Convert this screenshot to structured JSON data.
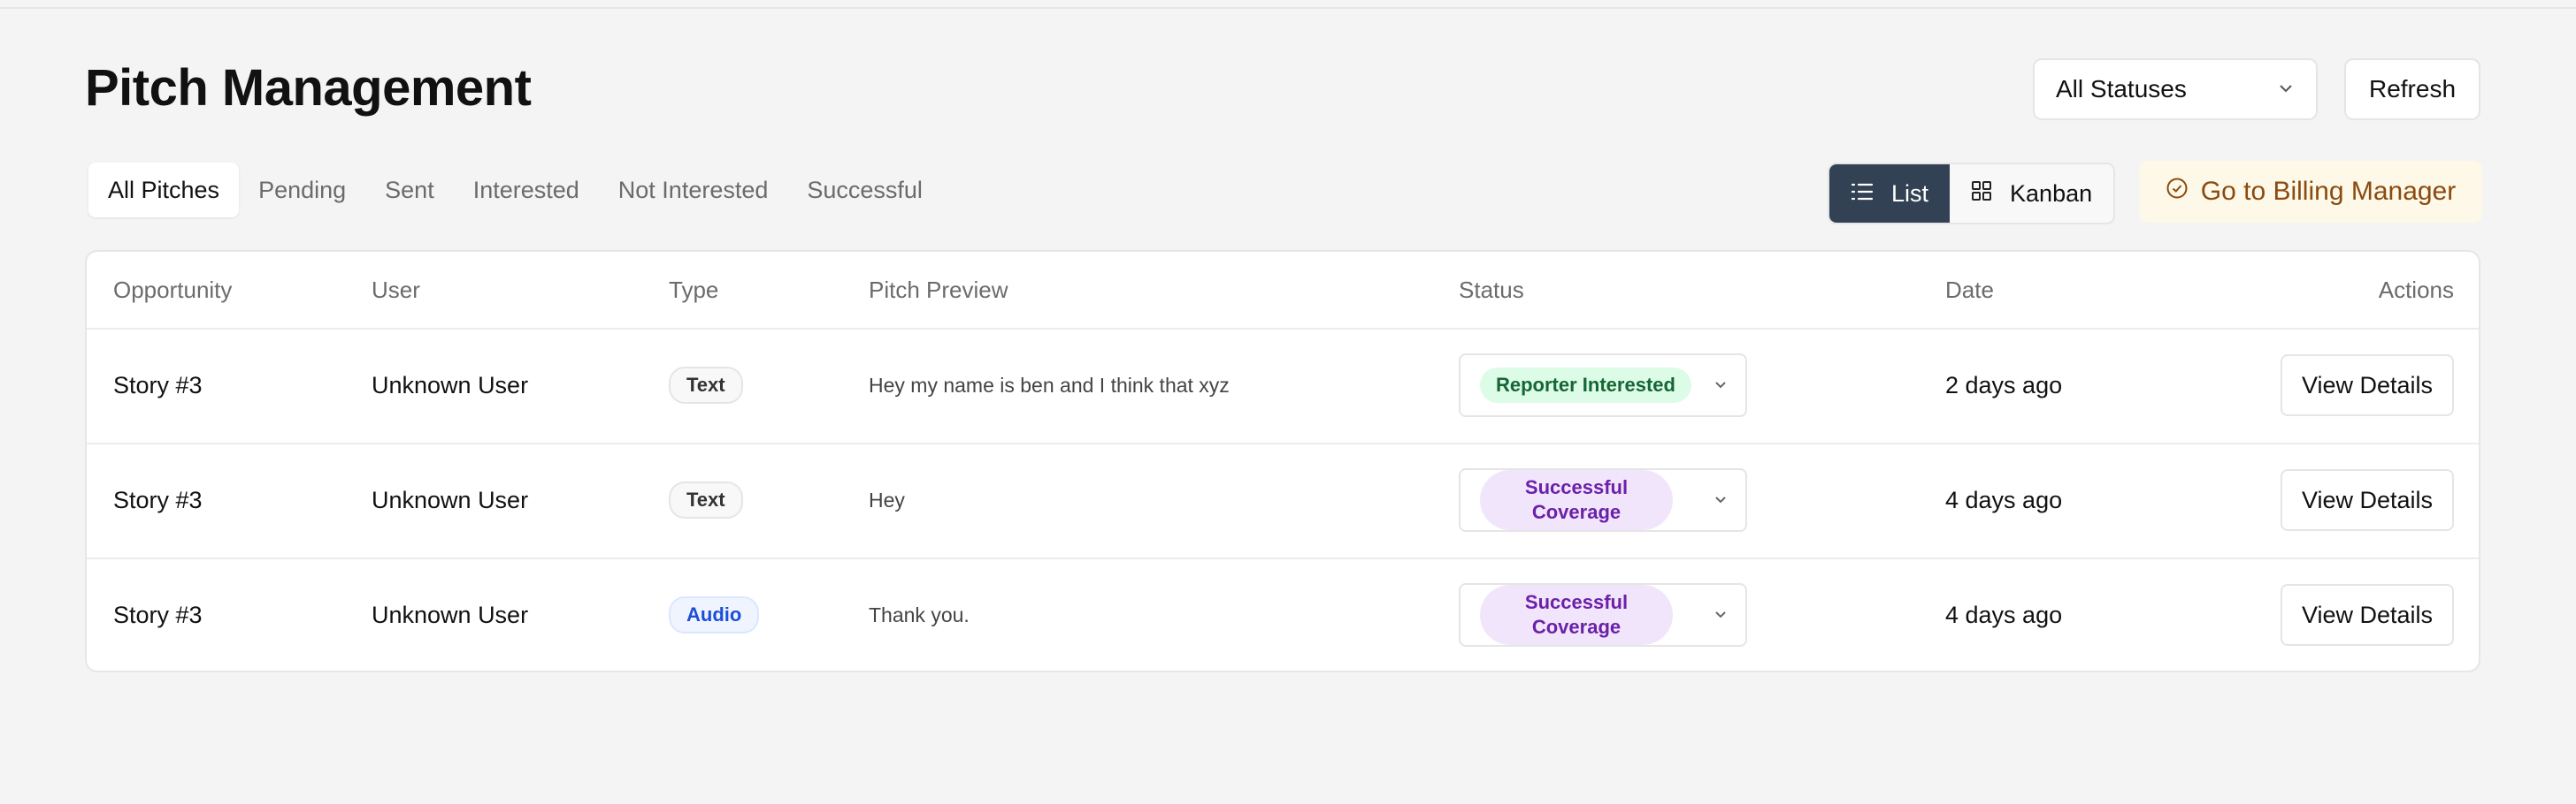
{
  "header": {
    "title": "Pitch Management",
    "status_filter": {
      "selected": "All Statuses"
    },
    "refresh_label": "Refresh"
  },
  "tabs": [
    {
      "label": "All Pitches",
      "active": true
    },
    {
      "label": "Pending",
      "active": false
    },
    {
      "label": "Sent",
      "active": false
    },
    {
      "label": "Interested",
      "active": false
    },
    {
      "label": "Not Interested",
      "active": false
    },
    {
      "label": "Successful",
      "active": false
    }
  ],
  "view_toggle": {
    "list_label": "List",
    "kanban_label": "Kanban",
    "active": "List"
  },
  "billing_button_label": "Go to Billing Manager",
  "table": {
    "columns": [
      "Opportunity",
      "User",
      "Type",
      "Pitch Preview",
      "Status",
      "Date",
      "Actions"
    ],
    "rows": [
      {
        "opportunity": "Story #3",
        "user": "Unknown User",
        "type": "Text",
        "preview": "Hey my name is ben and I think that xyz",
        "status": "Reporter Interested",
        "date": "2 days ago",
        "action": "View Details"
      },
      {
        "opportunity": "Story #3",
        "user": "Unknown User",
        "type": "Text",
        "preview": "Hey",
        "status": "Successful Coverage",
        "date": "4 days ago",
        "action": "View Details"
      },
      {
        "opportunity": "Story #3",
        "user": "Unknown User",
        "type": "Audio",
        "preview": "Thank you.",
        "status": "Successful Coverage",
        "date": "4 days ago",
        "action": "View Details"
      }
    ]
  },
  "colors": {
    "background": "#f4f4f4",
    "list_active": "#334155",
    "billing_bg": "#fdf8e7",
    "billing_text": "#8a4a10",
    "interested_bg": "#dcfce7",
    "successful_bg": "#f1e5fc",
    "audio_text": "#1d4ed8"
  },
  "icons": [
    "chevron-down-icon",
    "list-icon",
    "grid-icon",
    "check-circle-icon"
  ]
}
